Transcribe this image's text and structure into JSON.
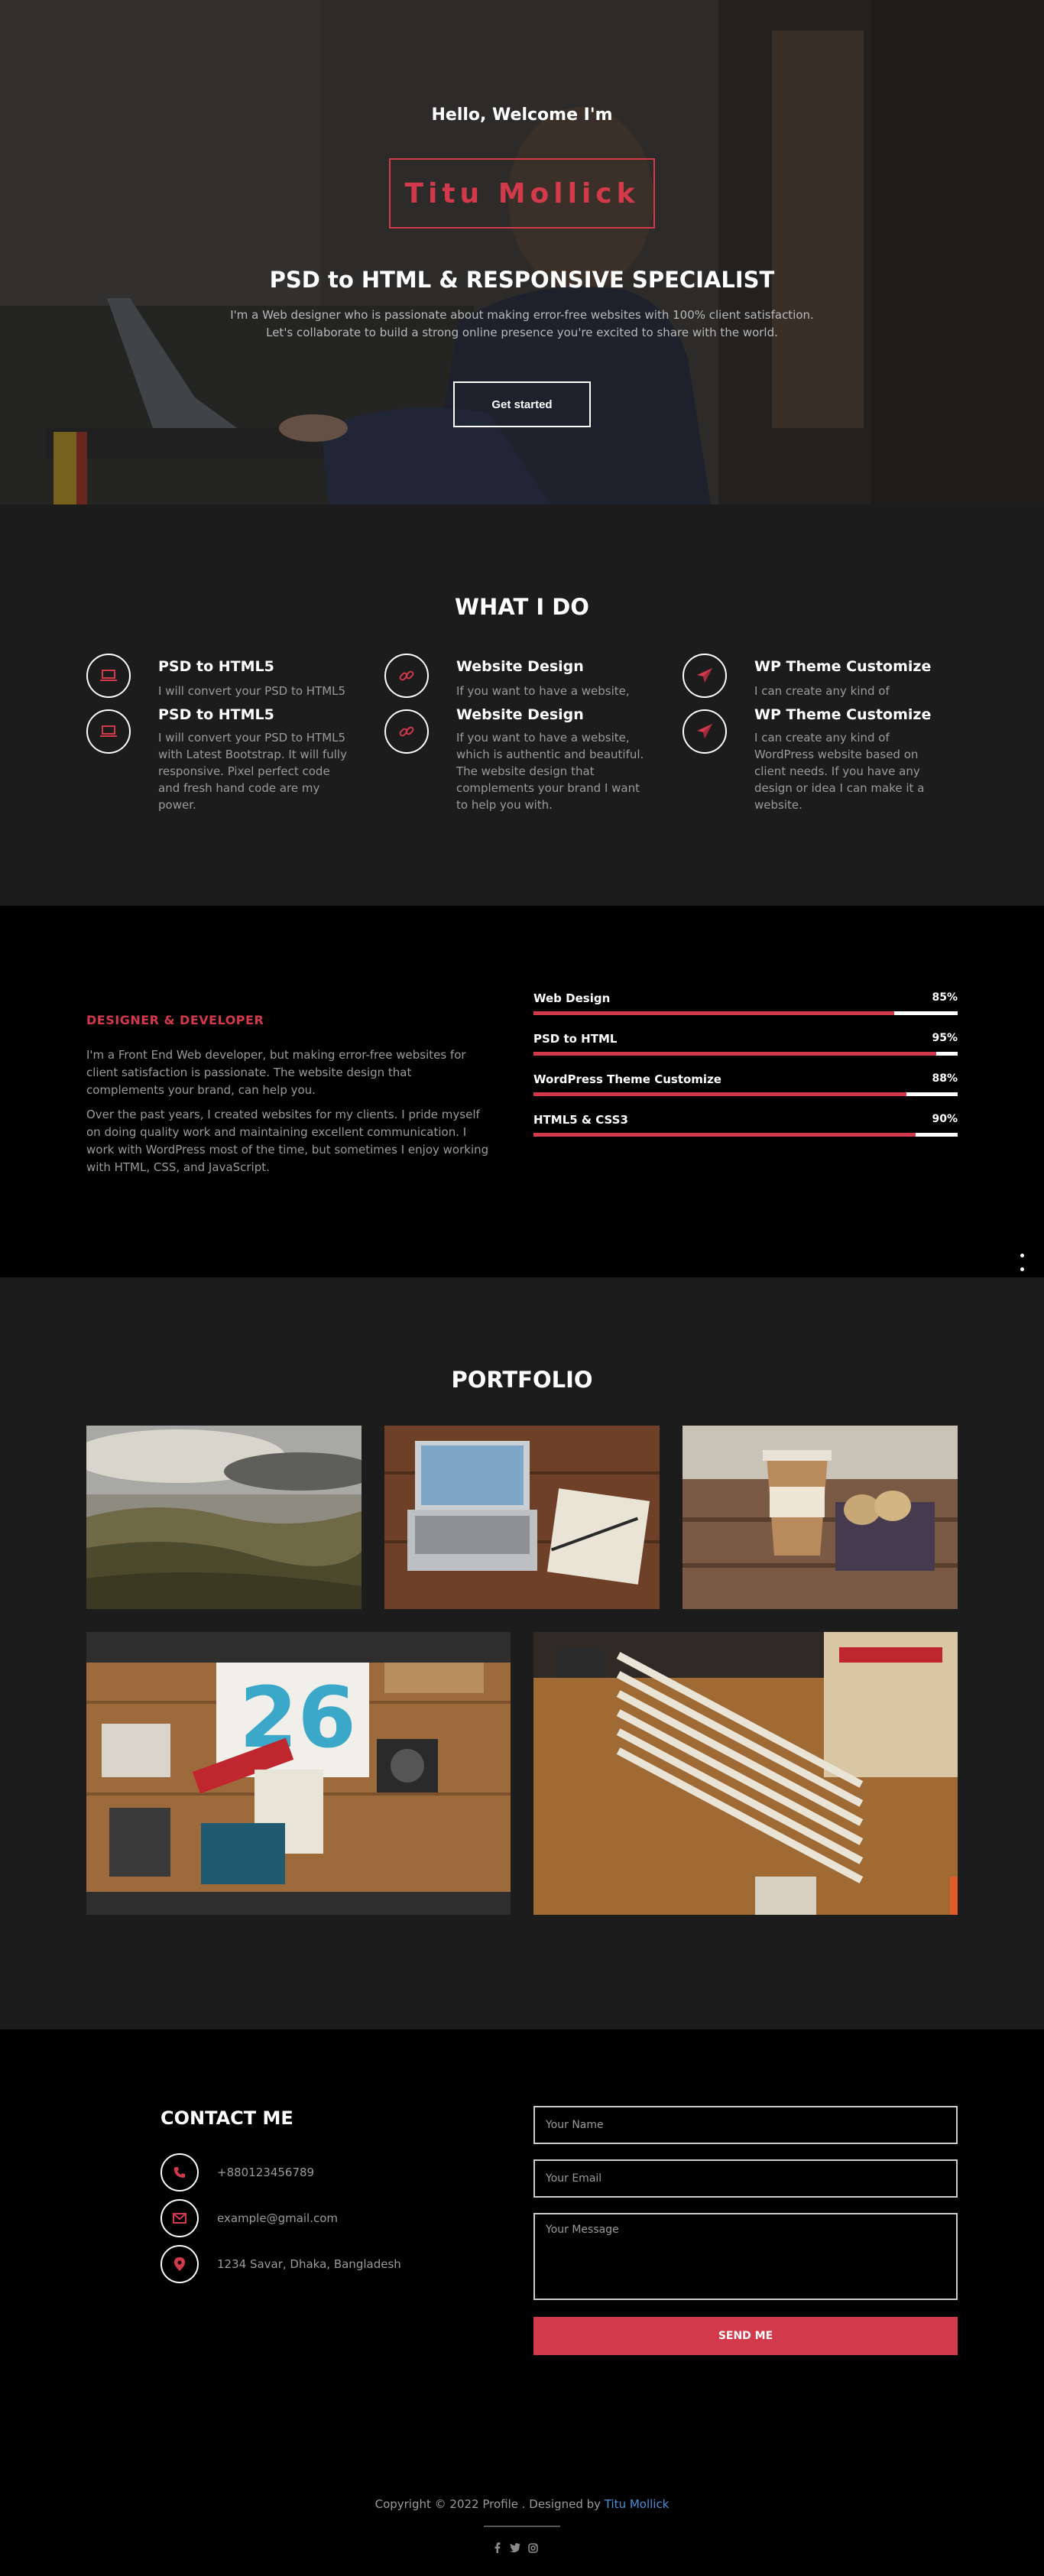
{
  "hero": {
    "greeting": "Hello, Welcome I'm",
    "name": "Titu Mollick",
    "title": "PSD to HTML & RESPONSIVE SPECIALIST",
    "description": "I'm a Web designer who is passionate about making error-free websites with 100% client satisfaction. Let's collaborate to build a strong online presence you're excited to share with the world.",
    "cta_label": "Get started"
  },
  "what_i_do": {
    "title": "WHAT I DO",
    "services": [
      {
        "icon": "laptop-icon",
        "title": "PSD to HTML5",
        "text": "I will convert your PSD to HTML5 with Latest Bootstrap. It will fully responsive. Pixel perfect code and fresh hand code are my power."
      },
      {
        "icon": "link-icon",
        "title": "Website Design",
        "text": "If you want to have a website, which is authentic and beautiful. The website design that complements your brand I want to help you with."
      },
      {
        "icon": "paper-plane-icon",
        "title": "WP Theme Customize",
        "text": "I can create any kind of WordPress website based on client needs. If you have any design or idea I can make it a website."
      }
    ]
  },
  "about": {
    "heading": "DESIGNER & DEVELOPER",
    "paragraph1": "I'm a Front End Web developer, but making error-free websites for client satisfaction is passionate. The website design that complements your brand, can help you.",
    "paragraph2": "Over the past years, I created websites for my clients. I pride myself on doing quality work and maintaining excellent communication. I work with WordPress most of the time, but sometimes I enjoy working with HTML, CSS, and JavaScript.",
    "skills": [
      {
        "name": "Web Design",
        "label": "85%",
        "value": 85
      },
      {
        "name": "PSD to HTML",
        "label": "95%",
        "value": 95
      },
      {
        "name": "WordPress Theme Customize",
        "label": "88%",
        "value": 88
      },
      {
        "name": "HTML5 & CSS3",
        "label": "90%",
        "value": 90
      }
    ]
  },
  "side_nav": {
    "count": 5,
    "active_index": 3
  },
  "portfolio": {
    "title": "PORTFOLIO",
    "items": [
      "landscape",
      "laptop-desk",
      "coffee-cookies",
      "design-tools",
      "pencils"
    ]
  },
  "contact": {
    "title": "CONTACT ME",
    "phone": "+880123456789",
    "email": "example@gmail.com",
    "address": "1234 Savar, Dhaka, Bangladesh",
    "name_placeholder": "Your Name",
    "email_placeholder": "Your Email",
    "message_placeholder": "Your Message",
    "send_label": "SEND ME"
  },
  "footer": {
    "copyright": "Copyright © 2022 Profile . Designed by",
    "designer": "Titu Mollick",
    "social": [
      "facebook-icon",
      "twitter-icon",
      "instagram-icon"
    ]
  },
  "colors": {
    "accent": "#d2394a",
    "dark": "#1c1c1c",
    "black": "#000000"
  }
}
